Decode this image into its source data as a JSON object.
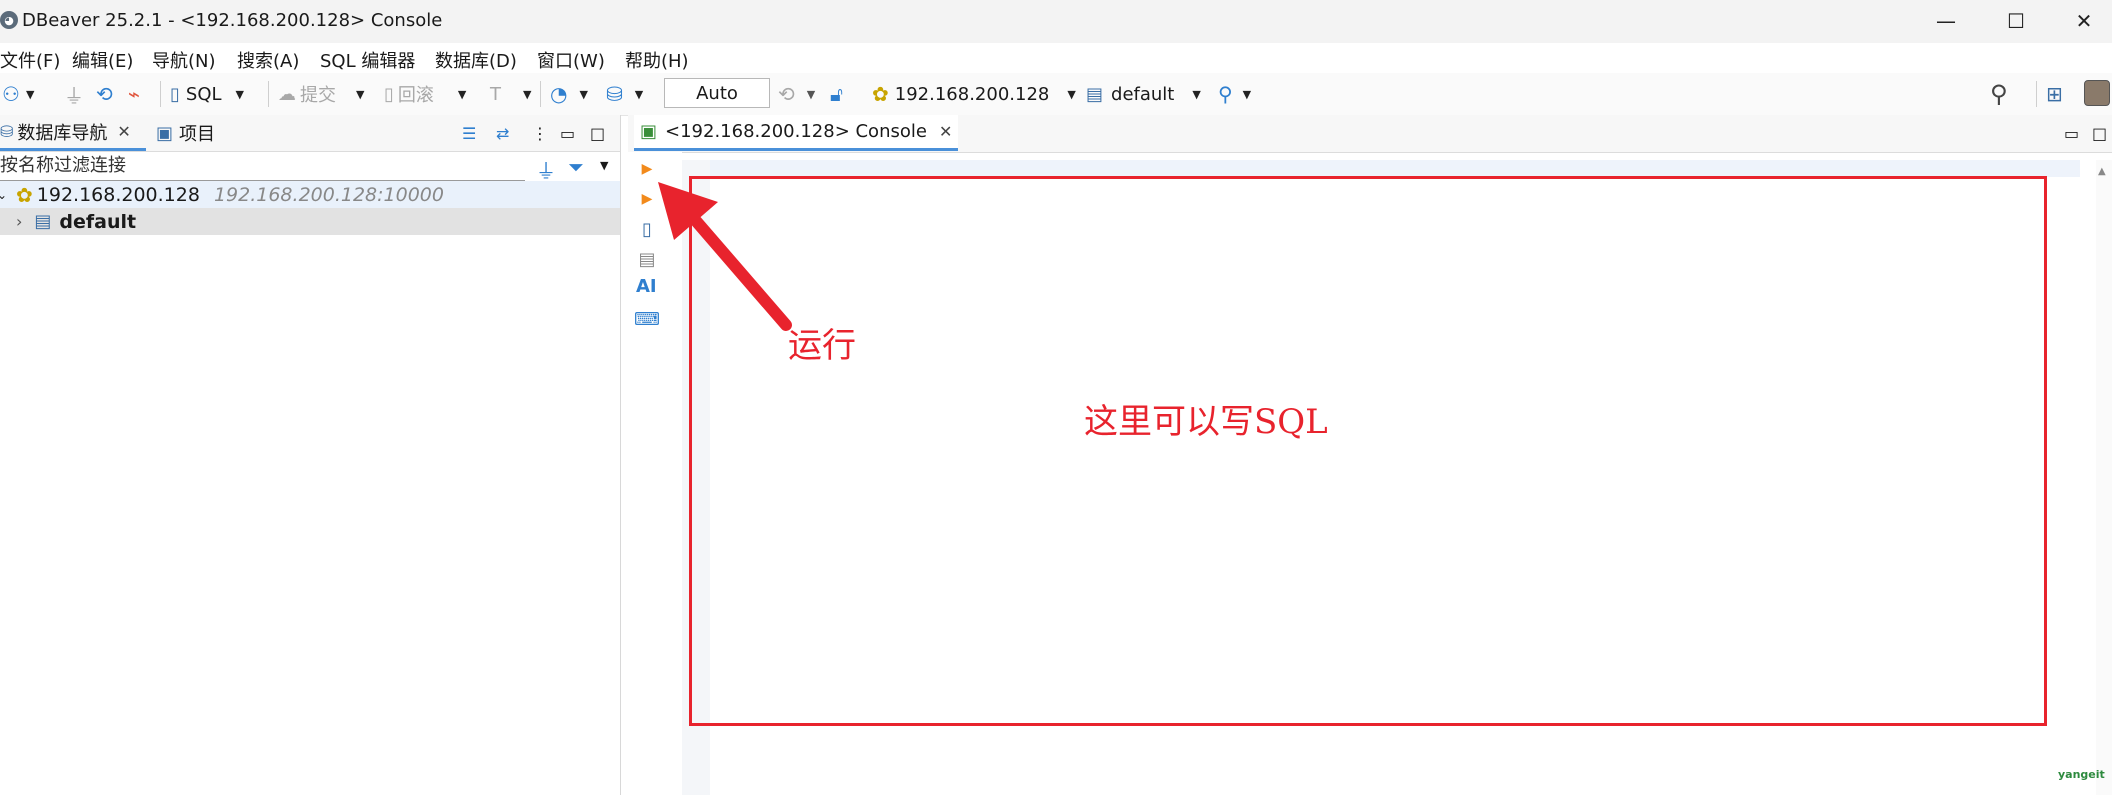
{
  "window": {
    "title": "DBeaver 25.2.1 - <192.168.200.128> Console",
    "minimize": "—",
    "maximize": "☐",
    "close": "✕"
  },
  "menu": [
    "文件(F)",
    "编辑(E)",
    "导航(N)",
    "搜索(A)",
    "SQL 编辑器",
    "数据库(D)",
    "窗口(W)",
    "帮助(H)"
  ],
  "toolbar": {
    "sql": "SQL",
    "commit": "提交",
    "rollback": "回滚",
    "transaction_mode": "Auto",
    "datasource": "192.168.200.128",
    "schema": "default"
  },
  "left_panel": {
    "tab_navigator": "数据库导航",
    "tab_projects": "项目",
    "filter_placeholder": "按名称过滤连接",
    "tree": {
      "connection_name": "192.168.200.128",
      "connection_host": "192.168.200.128:10000",
      "child": "default"
    }
  },
  "editor": {
    "tab_label": "<192.168.200.128> Console",
    "side_ai": "AI"
  },
  "annotations": {
    "run_label": "运行",
    "write_sql_label": "这里可以写SQL"
  },
  "watermark": "yangeit",
  "colors": {
    "annotation_red": "#e8232d",
    "tab_accent": "#4a90d9",
    "run_orange": "#f28a1b"
  }
}
